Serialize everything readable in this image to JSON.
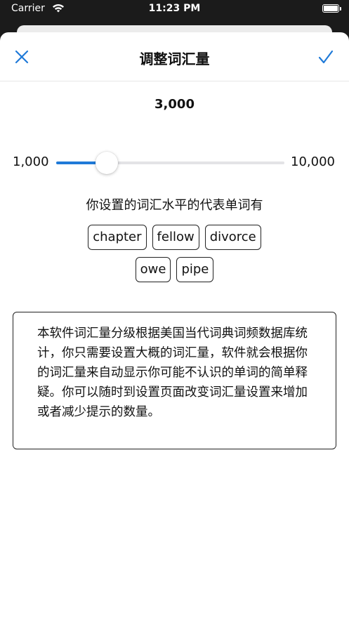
{
  "status": {
    "carrier": "Carrier",
    "time": "11:23 PM"
  },
  "nav": {
    "title": "调整词汇量"
  },
  "vocab": {
    "value": "3,000",
    "min_label": "1,000",
    "max_label": "10,000",
    "level_fraction": 0.2222
  },
  "caption": "你设置的词汇水平的代表单词有",
  "words": [
    [
      "chapter",
      "fellow",
      "divorce"
    ],
    [
      "owe",
      "pipe"
    ]
  ],
  "info": "本软件词汇量分级根据美国当代词典词频数据库统计，你只需要设置大概的词汇量，软件就会根据你的词汇量来自动显示你可能不认识的单词的简单释疑。你可以随时到设置页面改变词汇量设置来增加或者减少提示的数量。",
  "colors": {
    "accent": "#1f7ad8",
    "track": "#e3e3e6"
  }
}
